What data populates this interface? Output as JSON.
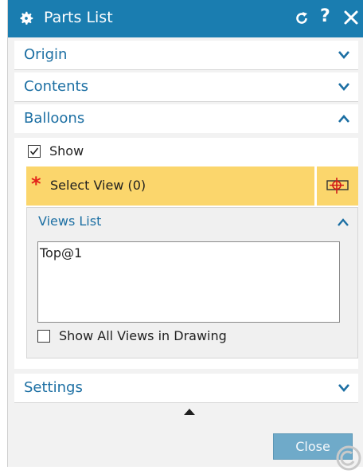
{
  "dialog": {
    "title": "Parts List",
    "title_icon": "gear-icon",
    "header_actions": {
      "reset_icon": "reset-icon",
      "help_label": "?",
      "close_icon": "close-x-icon"
    }
  },
  "groups": {
    "origin": {
      "label": "Origin",
      "state": "collapsed"
    },
    "contents": {
      "label": "Contents",
      "state": "collapsed"
    },
    "balloons": {
      "label": "Balloons",
      "state": "expanded"
    },
    "settings": {
      "label": "Settings",
      "state": "collapsed"
    }
  },
  "balloons": {
    "show_label": "Show",
    "show_checked": true,
    "select_view": {
      "required_marker": "*",
      "label": "Select View (0)"
    },
    "views_list": {
      "header": "Views List",
      "items": [
        "Top@1"
      ],
      "show_all_label": "Show All Views in Drawing",
      "show_all_checked": false
    }
  },
  "footer": {
    "close_label": "Close"
  },
  "colors": {
    "titlebar": "#1a7db0",
    "accent_text": "#1c6fa3",
    "selection_highlight": "#fbd66c",
    "required_star": "#e32219",
    "close_button": "#6faac9"
  }
}
